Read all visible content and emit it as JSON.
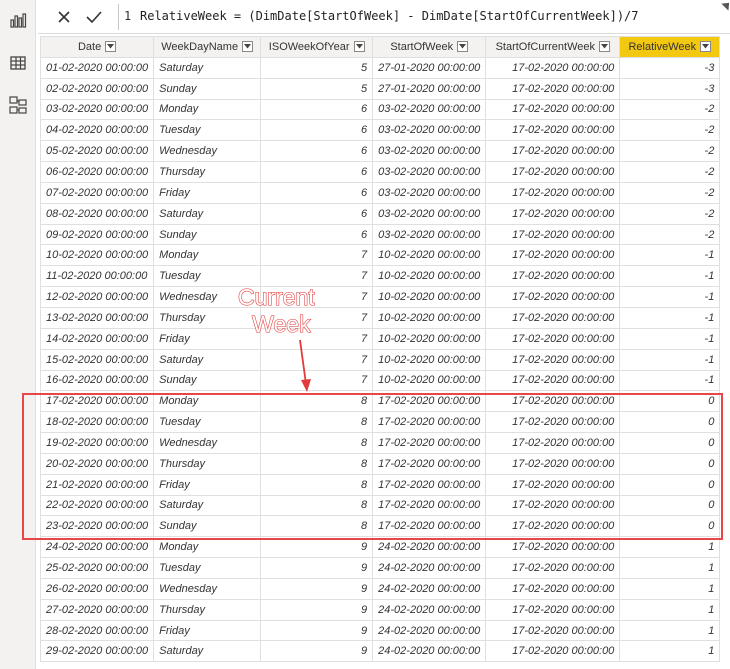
{
  "formula": {
    "line_number": "1",
    "text": "RelativeWeek = (DimDate[StartOfWeek] - DimDate[StartOfCurrentWeek])/7"
  },
  "rail": {
    "icons": [
      "report-view-icon",
      "data-view-icon",
      "model-view-icon"
    ]
  },
  "columns": [
    {
      "label": "Date",
      "highlight": false
    },
    {
      "label": "WeekDayName",
      "highlight": false
    },
    {
      "label": "ISOWeekOfYear",
      "highlight": false
    },
    {
      "label": "StartOfWeek",
      "highlight": false
    },
    {
      "label": "StartOfCurrentWeek",
      "highlight": false
    },
    {
      "label": "RelativeWeek",
      "highlight": true
    }
  ],
  "rows": [
    [
      "01-02-2020 00:00:00",
      "Saturday",
      "5",
      "27-01-2020 00:00:00",
      "17-02-2020 00:00:00",
      "-3"
    ],
    [
      "02-02-2020 00:00:00",
      "Sunday",
      "5",
      "27-01-2020 00:00:00",
      "17-02-2020 00:00:00",
      "-3"
    ],
    [
      "03-02-2020 00:00:00",
      "Monday",
      "6",
      "03-02-2020 00:00:00",
      "17-02-2020 00:00:00",
      "-2"
    ],
    [
      "04-02-2020 00:00:00",
      "Tuesday",
      "6",
      "03-02-2020 00:00:00",
      "17-02-2020 00:00:00",
      "-2"
    ],
    [
      "05-02-2020 00:00:00",
      "Wednesday",
      "6",
      "03-02-2020 00:00:00",
      "17-02-2020 00:00:00",
      "-2"
    ],
    [
      "06-02-2020 00:00:00",
      "Thursday",
      "6",
      "03-02-2020 00:00:00",
      "17-02-2020 00:00:00",
      "-2"
    ],
    [
      "07-02-2020 00:00:00",
      "Friday",
      "6",
      "03-02-2020 00:00:00",
      "17-02-2020 00:00:00",
      "-2"
    ],
    [
      "08-02-2020 00:00:00",
      "Saturday",
      "6",
      "03-02-2020 00:00:00",
      "17-02-2020 00:00:00",
      "-2"
    ],
    [
      "09-02-2020 00:00:00",
      "Sunday",
      "6",
      "03-02-2020 00:00:00",
      "17-02-2020 00:00:00",
      "-2"
    ],
    [
      "10-02-2020 00:00:00",
      "Monday",
      "7",
      "10-02-2020 00:00:00",
      "17-02-2020 00:00:00",
      "-1"
    ],
    [
      "11-02-2020 00:00:00",
      "Tuesday",
      "7",
      "10-02-2020 00:00:00",
      "17-02-2020 00:00:00",
      "-1"
    ],
    [
      "12-02-2020 00:00:00",
      "Wednesday",
      "7",
      "10-02-2020 00:00:00",
      "17-02-2020 00:00:00",
      "-1"
    ],
    [
      "13-02-2020 00:00:00",
      "Thursday",
      "7",
      "10-02-2020 00:00:00",
      "17-02-2020 00:00:00",
      "-1"
    ],
    [
      "14-02-2020 00:00:00",
      "Friday",
      "7",
      "10-02-2020 00:00:00",
      "17-02-2020 00:00:00",
      "-1"
    ],
    [
      "15-02-2020 00:00:00",
      "Saturday",
      "7",
      "10-02-2020 00:00:00",
      "17-02-2020 00:00:00",
      "-1"
    ],
    [
      "16-02-2020 00:00:00",
      "Sunday",
      "7",
      "10-02-2020 00:00:00",
      "17-02-2020 00:00:00",
      "-1"
    ],
    [
      "17-02-2020 00:00:00",
      "Monday",
      "8",
      "17-02-2020 00:00:00",
      "17-02-2020 00:00:00",
      "0"
    ],
    [
      "18-02-2020 00:00:00",
      "Tuesday",
      "8",
      "17-02-2020 00:00:00",
      "17-02-2020 00:00:00",
      "0"
    ],
    [
      "19-02-2020 00:00:00",
      "Wednesday",
      "8",
      "17-02-2020 00:00:00",
      "17-02-2020 00:00:00",
      "0"
    ],
    [
      "20-02-2020 00:00:00",
      "Thursday",
      "8",
      "17-02-2020 00:00:00",
      "17-02-2020 00:00:00",
      "0"
    ],
    [
      "21-02-2020 00:00:00",
      "Friday",
      "8",
      "17-02-2020 00:00:00",
      "17-02-2020 00:00:00",
      "0"
    ],
    [
      "22-02-2020 00:00:00",
      "Saturday",
      "8",
      "17-02-2020 00:00:00",
      "17-02-2020 00:00:00",
      "0"
    ],
    [
      "23-02-2020 00:00:00",
      "Sunday",
      "8",
      "17-02-2020 00:00:00",
      "17-02-2020 00:00:00",
      "0"
    ],
    [
      "24-02-2020 00:00:00",
      "Monday",
      "9",
      "24-02-2020 00:00:00",
      "17-02-2020 00:00:00",
      "1"
    ],
    [
      "25-02-2020 00:00:00",
      "Tuesday",
      "9",
      "24-02-2020 00:00:00",
      "17-02-2020 00:00:00",
      "1"
    ],
    [
      "26-02-2020 00:00:00",
      "Wednesday",
      "9",
      "24-02-2020 00:00:00",
      "17-02-2020 00:00:00",
      "1"
    ],
    [
      "27-02-2020 00:00:00",
      "Thursday",
      "9",
      "24-02-2020 00:00:00",
      "17-02-2020 00:00:00",
      "1"
    ],
    [
      "28-02-2020 00:00:00",
      "Friday",
      "9",
      "24-02-2020 00:00:00",
      "17-02-2020 00:00:00",
      "1"
    ],
    [
      "29-02-2020 00:00:00",
      "Saturday",
      "9",
      "24-02-2020 00:00:00",
      "17-02-2020 00:00:00",
      "1"
    ]
  ],
  "annotation": {
    "line1": "Current",
    "line2": "Week",
    "color": "#e23b3b"
  },
  "colors": {
    "header_highlight": "#f2c811",
    "annotation_red": "#e8474a"
  }
}
